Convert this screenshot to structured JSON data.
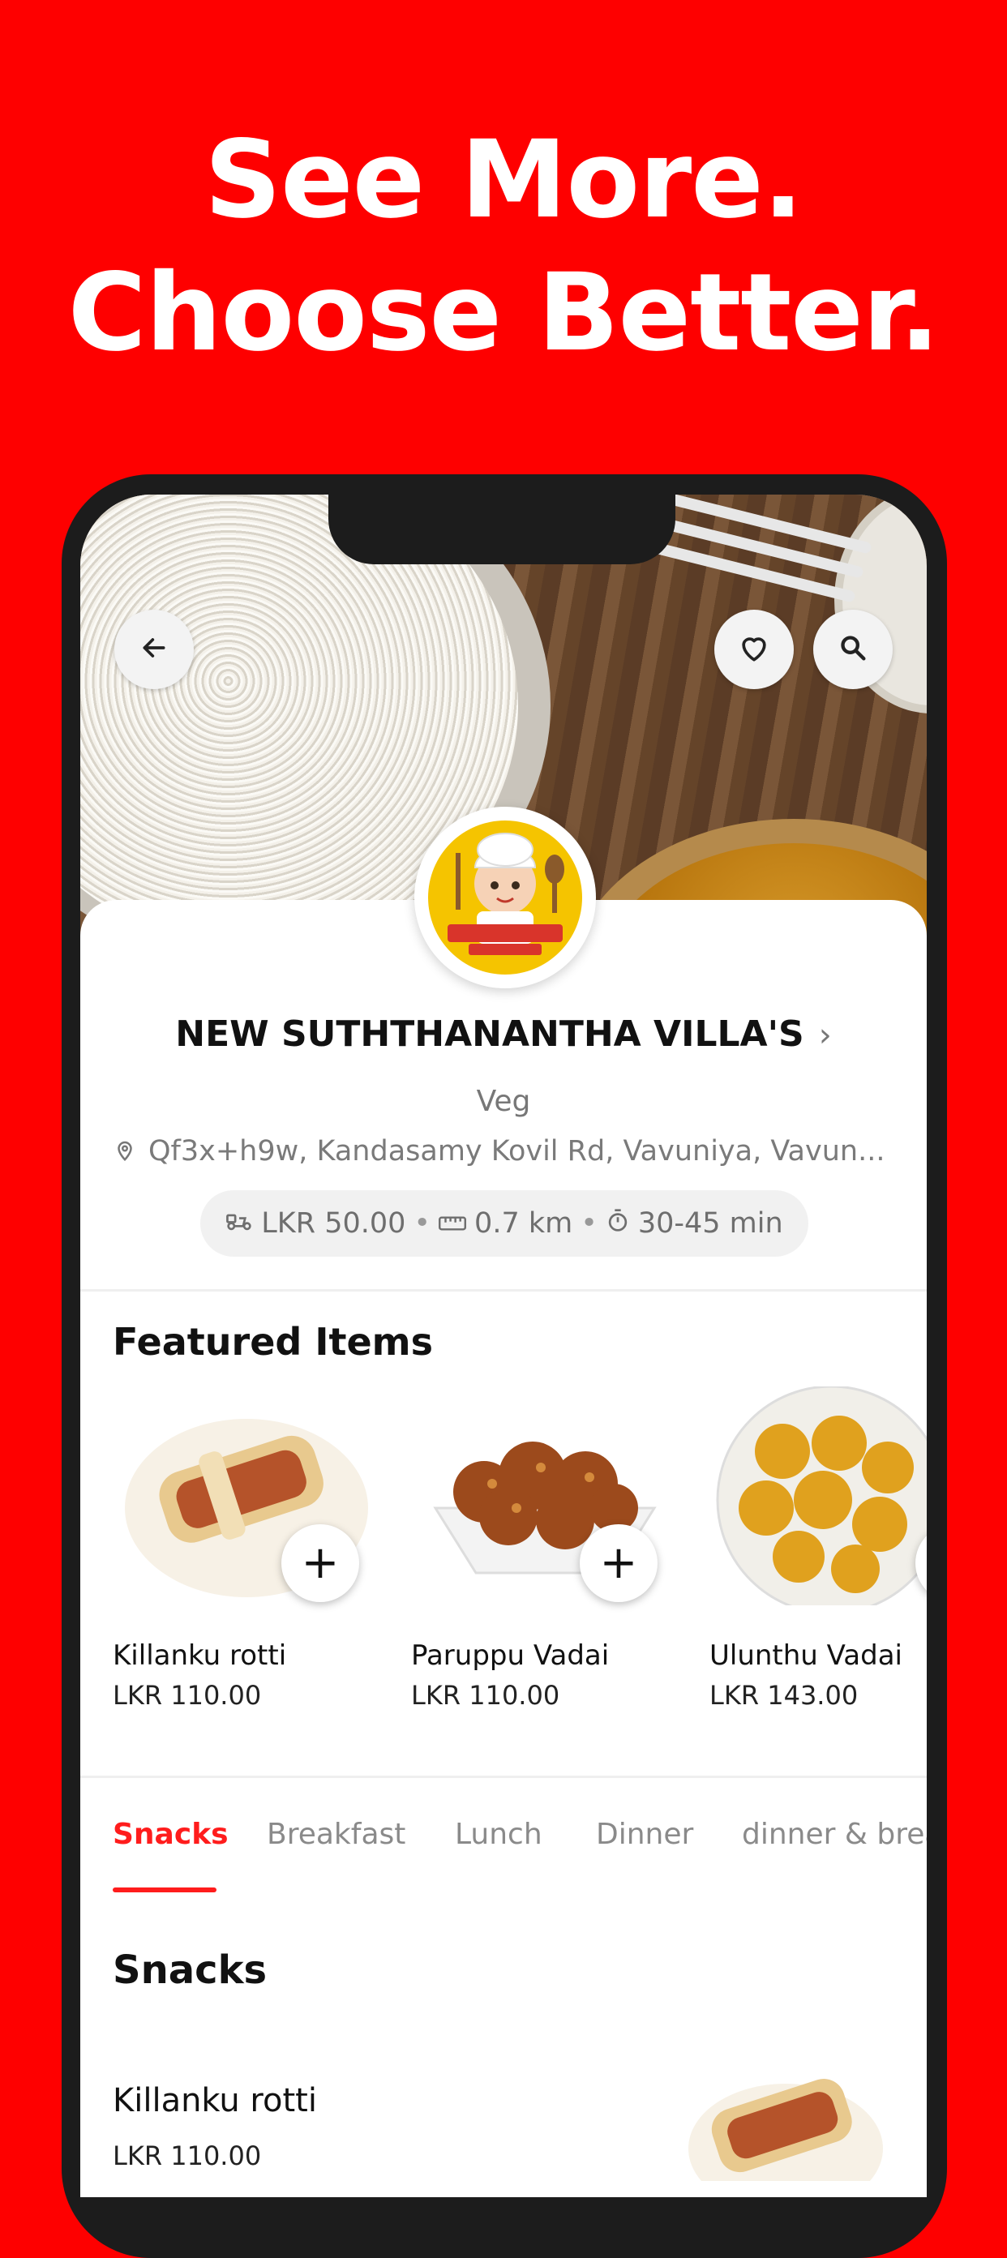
{
  "promo": {
    "line1": "See More.",
    "line2": "Choose Better."
  },
  "header": {
    "back_icon": "arrow-left-icon",
    "favorite_icon": "heart-icon",
    "search_icon": "search-icon"
  },
  "store": {
    "name": "NEW SUTHTHANANTHA VILLA'S",
    "cuisine": "Veg",
    "address": "Qf3x+h9w, Kandasamy Kovil Rd, Vavuniya, Vavun...",
    "delivery_fee": "LKR 50.00",
    "distance": "0.7 km",
    "eta": "30-45 min"
  },
  "featured": {
    "title": "Featured Items",
    "items": [
      {
        "name": "Killanku rotti",
        "price": "LKR 110.00"
      },
      {
        "name": "Paruppu Vadai",
        "price": "LKR 110.00"
      },
      {
        "name": "Ulunthu Vadai",
        "price": "LKR 143.00"
      }
    ]
  },
  "tabs": [
    "Snacks",
    "Breakfast",
    "Lunch",
    "Dinner",
    "dinner & brea"
  ],
  "active_tab": "Snacks",
  "menu_section": {
    "title": "Snacks",
    "items": [
      {
        "name": "Killanku rotti",
        "price": "LKR 110.00"
      }
    ]
  },
  "colors": {
    "background": "#fe0000",
    "accent": "#ff1c1c",
    "logo": "#f5c400"
  }
}
